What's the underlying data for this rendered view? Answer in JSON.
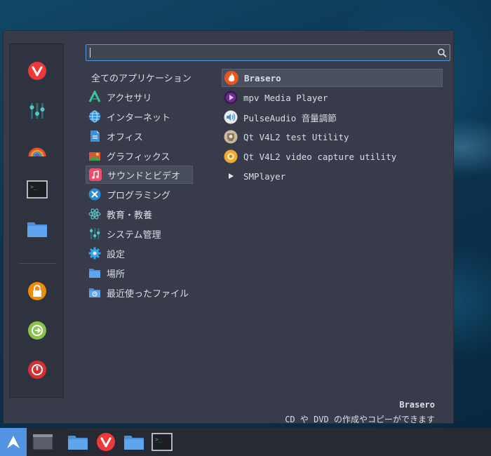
{
  "search": {
    "placeholder": "",
    "value": ""
  },
  "favorites": [
    {
      "name": "vivaldi-icon"
    },
    {
      "name": "mixer-icon"
    },
    {
      "name": "rainbow-app-icon"
    },
    {
      "name": "terminal-icon"
    },
    {
      "name": "folder-icon"
    },
    {
      "name": "lock-screen-icon"
    },
    {
      "name": "logout-icon"
    },
    {
      "name": "power-icon"
    }
  ],
  "categories": [
    {
      "label": "全てのアプリケーション",
      "icon": ""
    },
    {
      "label": "アクセサリ",
      "icon": "accessories-icon"
    },
    {
      "label": "インターネット",
      "icon": "internet-icon"
    },
    {
      "label": "オフィス",
      "icon": "office-icon"
    },
    {
      "label": "グラフィックス",
      "icon": "graphics-icon"
    },
    {
      "label": "サウンドとビデオ",
      "icon": "music-note-icon"
    },
    {
      "label": "プログラミング",
      "icon": "programming-icon"
    },
    {
      "label": "教育・教養",
      "icon": "education-atom-icon"
    },
    {
      "label": "システム管理",
      "icon": "system-admin-icon"
    },
    {
      "label": "設定",
      "icon": "settings-gear-icon"
    },
    {
      "label": "場所",
      "icon": "places-folder-icon"
    },
    {
      "label": "最近使ったファイル",
      "icon": "recent-files-icon"
    }
  ],
  "selected_category": "サウンドとビデオ",
  "apps": [
    {
      "label": "Brasero",
      "icon": "brasero-flame-icon"
    },
    {
      "label": "mpv Media Player",
      "icon": "mpv-icon"
    },
    {
      "label": "PulseAudio 音量調節",
      "icon": "speaker-icon"
    },
    {
      "label": "Qt V4L2 test Utility",
      "icon": "webcam-icon"
    },
    {
      "label": "Qt V4L2 video capture utility",
      "icon": "webcam-capture-icon"
    },
    {
      "label": "SMPlayer",
      "icon": "play-icon"
    }
  ],
  "info": {
    "title": "Brasero",
    "description": "CD や DVD の作成やコピーができます"
  },
  "taskbar": [
    {
      "name": "start-menu-icon"
    },
    {
      "name": "show-desktop-icon"
    },
    {
      "name": "file-manager-icon"
    },
    {
      "name": "vivaldi-icon"
    },
    {
      "name": "folder-icon"
    },
    {
      "name": "terminal-icon"
    }
  ],
  "colors": {
    "accent": "#5294e2",
    "panel": "#383c4a",
    "taskbar": "#262a33",
    "start": "#5294e2"
  }
}
